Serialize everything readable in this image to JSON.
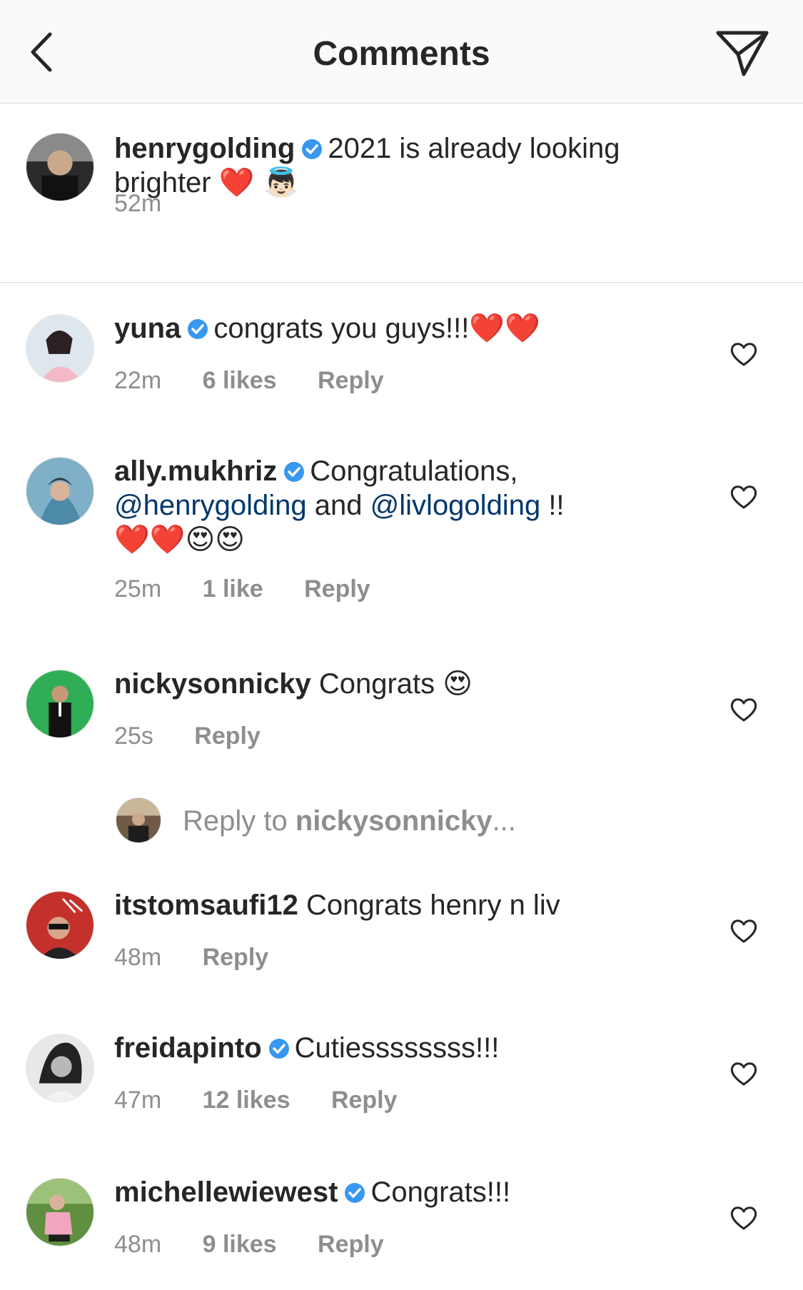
{
  "header": {
    "title": "Comments",
    "back_icon": "chevron-left-icon",
    "share_icon": "paper-plane-icon"
  },
  "caption": {
    "username": "henrygolding",
    "verified": true,
    "text": "2021 is already looking brighter",
    "emojis": "❤️ 👼🏻",
    "time": "52m"
  },
  "comments": [
    {
      "username": "yuna",
      "verified": true,
      "text": "congrats you guys!!!",
      "emojis": "❤️❤️",
      "time": "22m",
      "likes": "6 likes",
      "reply": "Reply"
    },
    {
      "username": "ally.mukhriz",
      "verified": true,
      "text_before": "Congratulations,",
      "mention1": "@henrygolding",
      "text_mid": "and",
      "mention2": "@livlogolding",
      "text_after": "!!",
      "emojis": "❤️❤️😍😍",
      "time": "25m",
      "likes": "1 like",
      "reply": "Reply"
    },
    {
      "username": "nickysonnicky",
      "verified": false,
      "text": "Congrats",
      "emojis": "😍",
      "time": "25s",
      "reply": "Reply"
    },
    {
      "username": "itstomsaufi12",
      "verified": false,
      "text": "Congrats henry n liv",
      "time": "48m",
      "reply": "Reply"
    },
    {
      "username": "freidapinto",
      "verified": true,
      "text": "Cutiessssssss!!!",
      "time": "47m",
      "likes": "12 likes",
      "reply": "Reply"
    },
    {
      "username": "michellewiewest",
      "verified": true,
      "text": "Congrats!!!",
      "time": "48m",
      "likes": "9 likes",
      "reply": "Reply"
    }
  ],
  "reply_prompt": {
    "prefix": "Reply to",
    "target": "nickysonnicky",
    "suffix": "..."
  },
  "colors": {
    "verified": "#3897f0",
    "mention": "#00376b",
    "meta": "#8e8e8e",
    "text": "#262626",
    "divider": "#dbdbdb",
    "header_bg": "#fafafa"
  }
}
